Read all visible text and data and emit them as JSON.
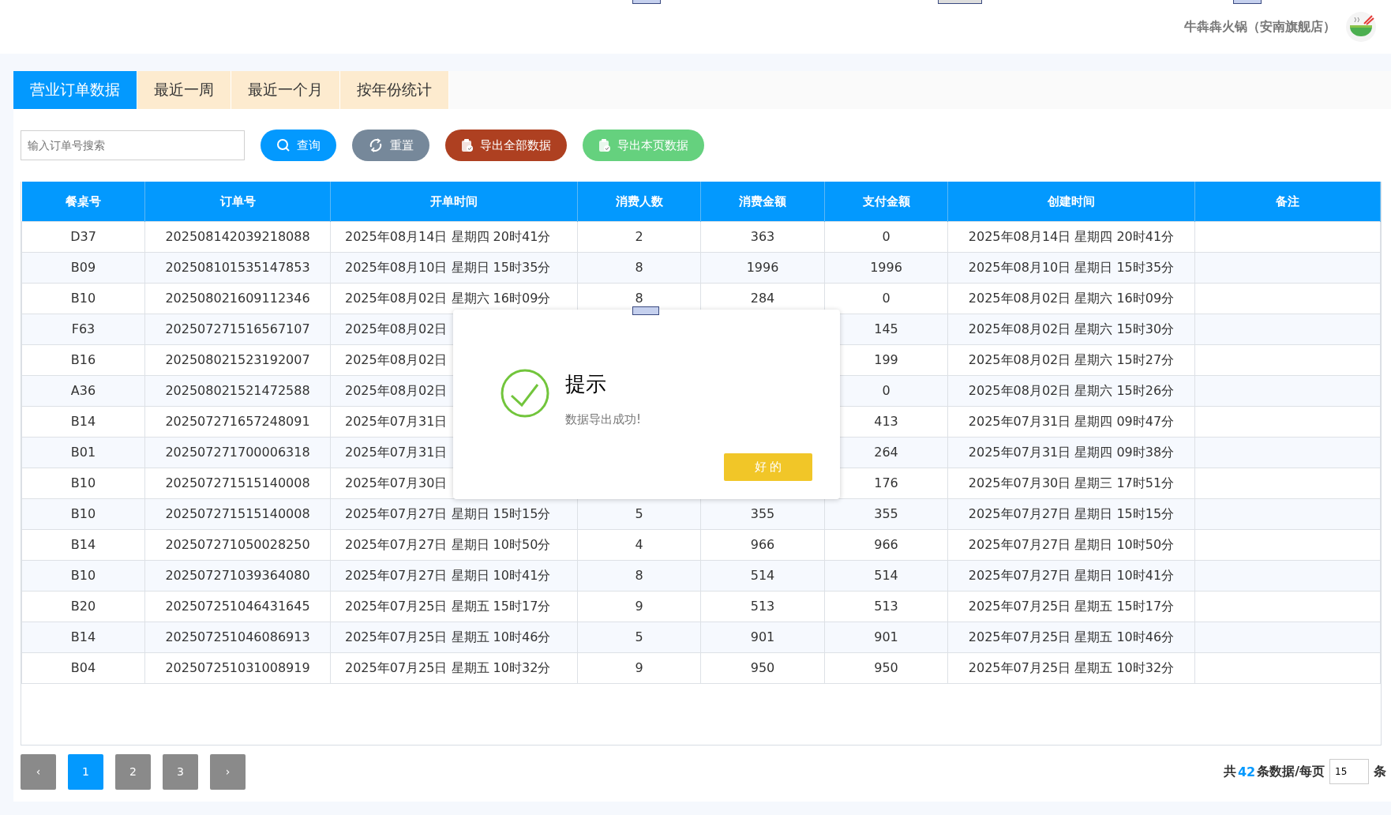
{
  "header": {
    "store_name": "牛犇犇火锅（安南旗舰店）"
  },
  "tabs": [
    {
      "label": "营业订单数据",
      "selected": true
    },
    {
      "label": "最近一周",
      "selected": false
    },
    {
      "label": "最近一个月",
      "selected": false
    },
    {
      "label": "按年份统计",
      "selected": false
    }
  ],
  "search": {
    "placeholder": "输入订单号搜索"
  },
  "buttons": [
    {
      "kind": "search",
      "label": "查询"
    },
    {
      "kind": "reset",
      "label": "重置"
    },
    {
      "kind": "export_all",
      "label": "导出全部数据"
    },
    {
      "kind": "export_page",
      "label": "导出本页数据"
    }
  ],
  "table": {
    "columns": [
      "餐桌号",
      "订单号",
      "开单时间",
      "消费人数",
      "消费金额",
      "支付金额",
      "创建时间",
      "备注"
    ],
    "rows": [
      {
        "table_no": "D37",
        "order_no": "202508142039218088",
        "open_time": "2025年08月14日 星期四 20时41分",
        "people": "2",
        "amount": "363",
        "paid": "0",
        "created": "2025年08月14日 星期四 20时41分"
      },
      {
        "table_no": "B09",
        "order_no": "202508101535147853",
        "open_time": "2025年08月10日 星期日 15时35分",
        "people": "8",
        "amount": "1996",
        "paid": "1996",
        "created": "2025年08月10日 星期日 15时35分"
      },
      {
        "table_no": "B10",
        "order_no": "202508021609112346",
        "open_time": "2025年08月02日 星期六 16时09分",
        "people": "8",
        "amount": "284",
        "paid": "0",
        "created": "2025年08月02日 星期六 16时09分"
      },
      {
        "table_no": "F63",
        "order_no": "202507271516567107",
        "open_time": "2025年08月02日",
        "paid": "145",
        "created": "2025年08月02日 星期六 15时30分"
      },
      {
        "table_no": "B16",
        "order_no": "202508021523192007",
        "open_time": "2025年08月02日",
        "paid": "199",
        "created": "2025年08月02日 星期六 15时27分"
      },
      {
        "table_no": "A36",
        "order_no": "202508021521472588",
        "open_time": "2025年08月02日",
        "paid": "0",
        "created": "2025年08月02日 星期六 15时26分"
      },
      {
        "table_no": "B14",
        "order_no": "202507271657248091",
        "open_time": "2025年07月31日",
        "paid": "413",
        "created": "2025年07月31日 星期四 09时47分"
      },
      {
        "table_no": "B01",
        "order_no": "202507271700006318",
        "open_time": "2025年07月31日",
        "paid": "264",
        "created": "2025年07月31日 星期四 09时38分"
      },
      {
        "table_no": "B10",
        "order_no": "202507271515140008",
        "open_time": "2025年07月30日",
        "paid": "176",
        "created": "2025年07月30日 星期三 17时51分"
      },
      {
        "table_no": "B10",
        "order_no": "202507271515140008",
        "open_time": "2025年07月27日 星期日 15时15分",
        "people": "5",
        "amount": "355",
        "paid": "355",
        "created": "2025年07月27日 星期日 15时15分"
      },
      {
        "table_no": "B14",
        "order_no": "202507271050028250",
        "open_time": "2025年07月27日 星期日 10时50分",
        "people": "4",
        "amount": "966",
        "paid": "966",
        "created": "2025年07月27日 星期日 10时50分"
      },
      {
        "table_no": "B10",
        "order_no": "202507271039364080",
        "open_time": "2025年07月27日 星期日 10时41分",
        "people": "8",
        "amount": "514",
        "paid": "514",
        "created": "2025年07月27日 星期日 10时41分"
      },
      {
        "table_no": "B20",
        "order_no": "202507251046431645",
        "open_time": "2025年07月25日 星期五 15时17分",
        "people": "9",
        "amount": "513",
        "paid": "513",
        "created": "2025年07月25日 星期五 15时17分"
      },
      {
        "table_no": "B14",
        "order_no": "202507251046086913",
        "open_time": "2025年07月25日 星期五 10时46分",
        "people": "5",
        "amount": "901",
        "paid": "901",
        "created": "2025年07月25日 星期五 10时46分"
      },
      {
        "table_no": "B04",
        "order_no": "202507251031008919",
        "open_time": "2025年07月25日 星期五 10时32分",
        "people": "9",
        "amount": "950",
        "paid": "950",
        "created": "2025年07月25日 星期五 10时32分"
      }
    ]
  },
  "pagination": {
    "prev": "‹",
    "pages": [
      {
        "label": "1",
        "selected": true
      },
      {
        "label": "2",
        "selected": false
      },
      {
        "label": "3",
        "selected": false
      }
    ],
    "next": "›",
    "total_prefix": "共",
    "total": "42",
    "total_suffix": "条数据/每页",
    "page_size": "15",
    "page_size_suffix": "条"
  },
  "dialog": {
    "title": "提示",
    "message": "数据导出成功!",
    "ok": "好 的"
  }
}
